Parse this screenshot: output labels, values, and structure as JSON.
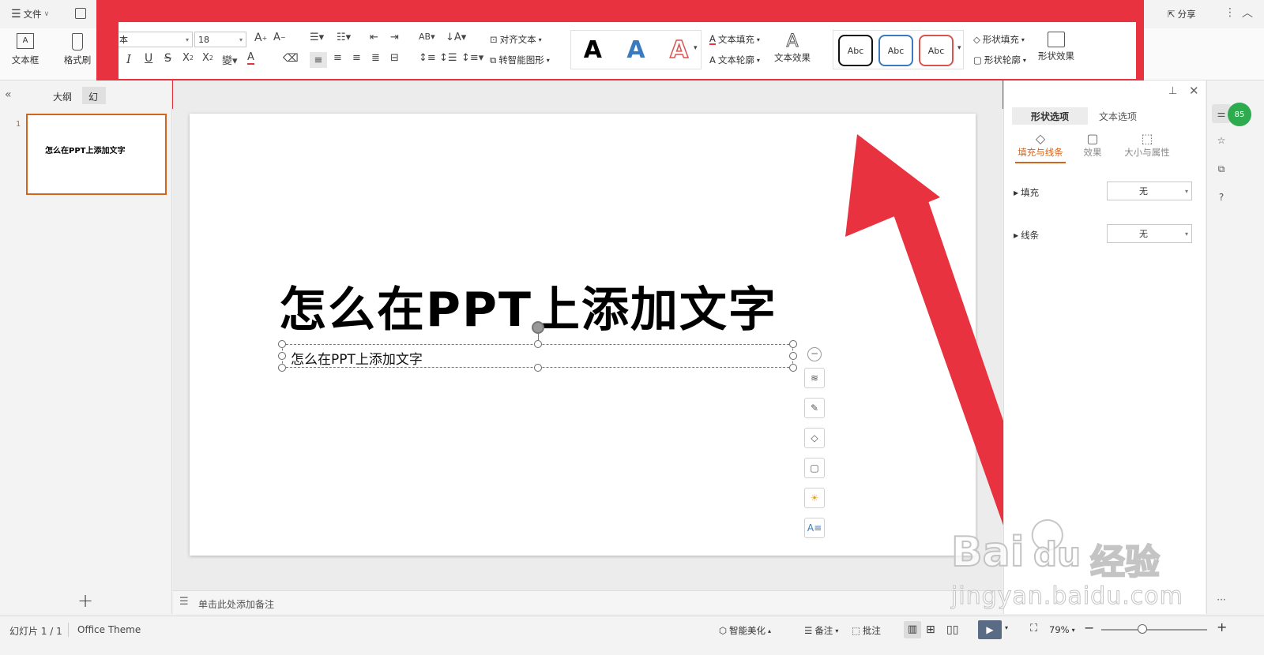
{
  "topbar": {
    "menu_label": "文件",
    "share_label": "分享"
  },
  "ribbon": {
    "textbox_label": "文本框",
    "format_brush_label": "格式刷",
    "font_name": "本",
    "font_size": "18",
    "align_text_label": "对齐文本",
    "smartart_label": "转智能图形",
    "text_fill_label": "文本填充",
    "text_outline_label": "文本轮廓",
    "text_effect_label": "文本效果",
    "style_a": "A",
    "shape_style_1": "Abc",
    "shape_style_2": "Abc",
    "shape_style_3": "Abc",
    "shape_fill_label": "形状填充",
    "shape_outline_label": "形状轮廓",
    "shape_effect_label": "形状效果"
  },
  "left_panel": {
    "tab_outline": "大纲",
    "tab_slide": "幻",
    "slide_number": "1",
    "thumb_title": "怎么在PPT上添加文字",
    "add_label": "+"
  },
  "slide": {
    "title": "怎么在PPT上添加文字",
    "textbox_text": "怎么在PPT上添加文字"
  },
  "notes": {
    "placeholder": "单击此处添加备注"
  },
  "right_panel": {
    "tab_shape_options": "形状选项",
    "tab_text_options": "文本选项",
    "sub_fill_line": "填充与线条",
    "sub_effect": "效果",
    "sub_size": "大小与属性",
    "fill_label": "填充",
    "fill_value": "无",
    "line_label": "线条",
    "line_value": "无",
    "badge": "85"
  },
  "statusbar": {
    "slide_info": "幻灯片 1 / 1",
    "theme": "Office Theme",
    "smart_beautify": "智能美化",
    "notes_label": "备注",
    "comments_label": "批注",
    "zoom": "79%"
  },
  "watermark": {
    "brand": "Bai",
    "brand2": "du",
    "brand_cn": "经验",
    "url": "jingyan.baidu.com"
  },
  "colors": {
    "annotation_red": "#e8323f",
    "accent_orange": "#d2641e",
    "fill_blue": "#3a7bbf"
  }
}
